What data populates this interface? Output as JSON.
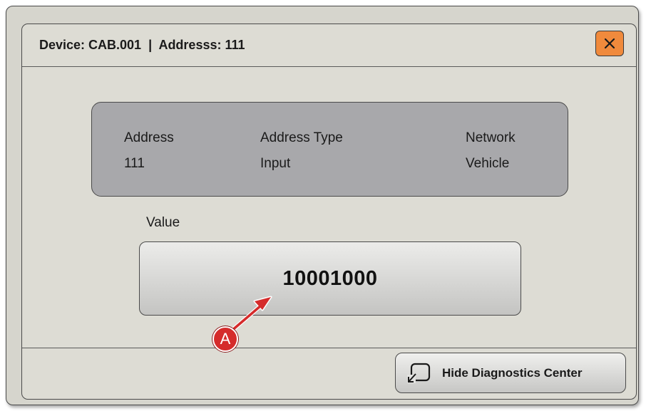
{
  "dialog": {
    "title": "Device: CAB.001  |  Addresss: 111",
    "close_icon": "close-icon"
  },
  "info_panel": {
    "columns": [
      {
        "header": "Address",
        "value": "111"
      },
      {
        "header": "Address Type",
        "value": "Input"
      },
      {
        "header": "Network",
        "value": "Vehicle"
      }
    ]
  },
  "value_section": {
    "label": "Value",
    "value": "10001000"
  },
  "footer": {
    "hide_button_label": "Hide Diagnostics Center",
    "hide_button_icon": "minimize-window-icon"
  },
  "callout": {
    "label": "A",
    "color": "#d52b2b"
  },
  "colors": {
    "close_button": "#f08a3c",
    "info_panel": "#a8a8ab",
    "dialog_background": "#dddcd4"
  }
}
